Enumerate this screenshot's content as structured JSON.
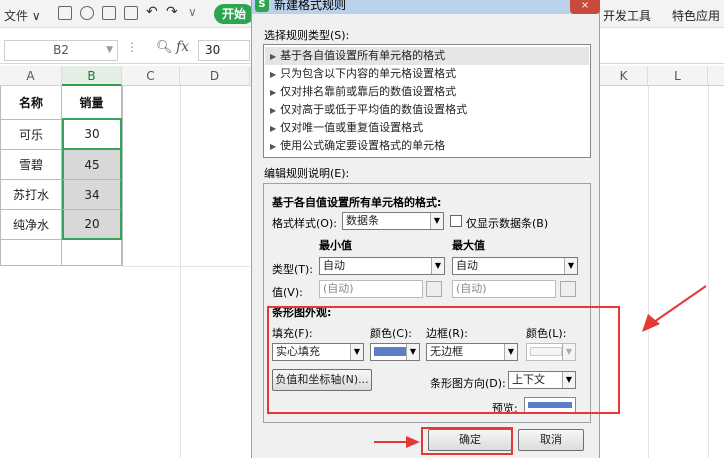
{
  "toolbar": {
    "file_menu": "文件",
    "start_tab": "开始",
    "dev_tools": "开发工具",
    "special_apps": "特色应用"
  },
  "formula_bar": {
    "cell_ref": "B2",
    "value": "30"
  },
  "columns": [
    "A",
    "B",
    "C",
    "D",
    "K",
    "L"
  ],
  "table": {
    "header": [
      "名称",
      "销量"
    ],
    "rows": [
      {
        "name": "可乐",
        "sales": "30"
      },
      {
        "name": "雪碧",
        "sales": "45"
      },
      {
        "name": "苏打水",
        "sales": "34"
      },
      {
        "name": "纯净水",
        "sales": "20"
      }
    ]
  },
  "dialog": {
    "title": "新建格式规则",
    "rule_type_label": "选择规则类型(S):",
    "rule_types": [
      "基于各自值设置所有单元格的格式",
      "只为包含以下内容的单元格设置格式",
      "仅对排名靠前或靠后的数值设置格式",
      "仅对高于或低于平均值的数值设置格式",
      "仅对唯一值或重复值设置格式",
      "使用公式确定要设置格式的单元格"
    ],
    "edit_desc_label": "编辑规则说明(E):",
    "desc_title": "基于各自值设置所有单元格的格式:",
    "format_style_label": "格式样式(O):",
    "format_style_value": "数据条",
    "show_bar_only_label": "仅显示数据条(B)",
    "min_label": "最小值",
    "max_label": "最大值",
    "type_label": "类型(T):",
    "min_type": "自动",
    "max_type": "自动",
    "value_label": "值(V):",
    "min_value": "(自动)",
    "max_value": "(自动)",
    "bar_appearance_title": "条形图外观:",
    "fill_label": "填充(F):",
    "fill_color_label": "颜色(C):",
    "border_label": "边框(R):",
    "border_color_label": "颜色(L):",
    "fill_value": "实心填充",
    "border_value": "无边框",
    "neg_axis_button": "负值和坐标轴(N)...",
    "direction_label": "条形图方向(D):",
    "direction_value": "上下文",
    "preview_label": "预览:",
    "ok_button": "确定",
    "cancel_button": "取消",
    "close_icon": "×",
    "fill_color": "#5b7fc7",
    "preview_color": "#5b7fc7"
  },
  "colors": {
    "accent_green": "#2da44e",
    "highlight_red": "#e53935"
  }
}
